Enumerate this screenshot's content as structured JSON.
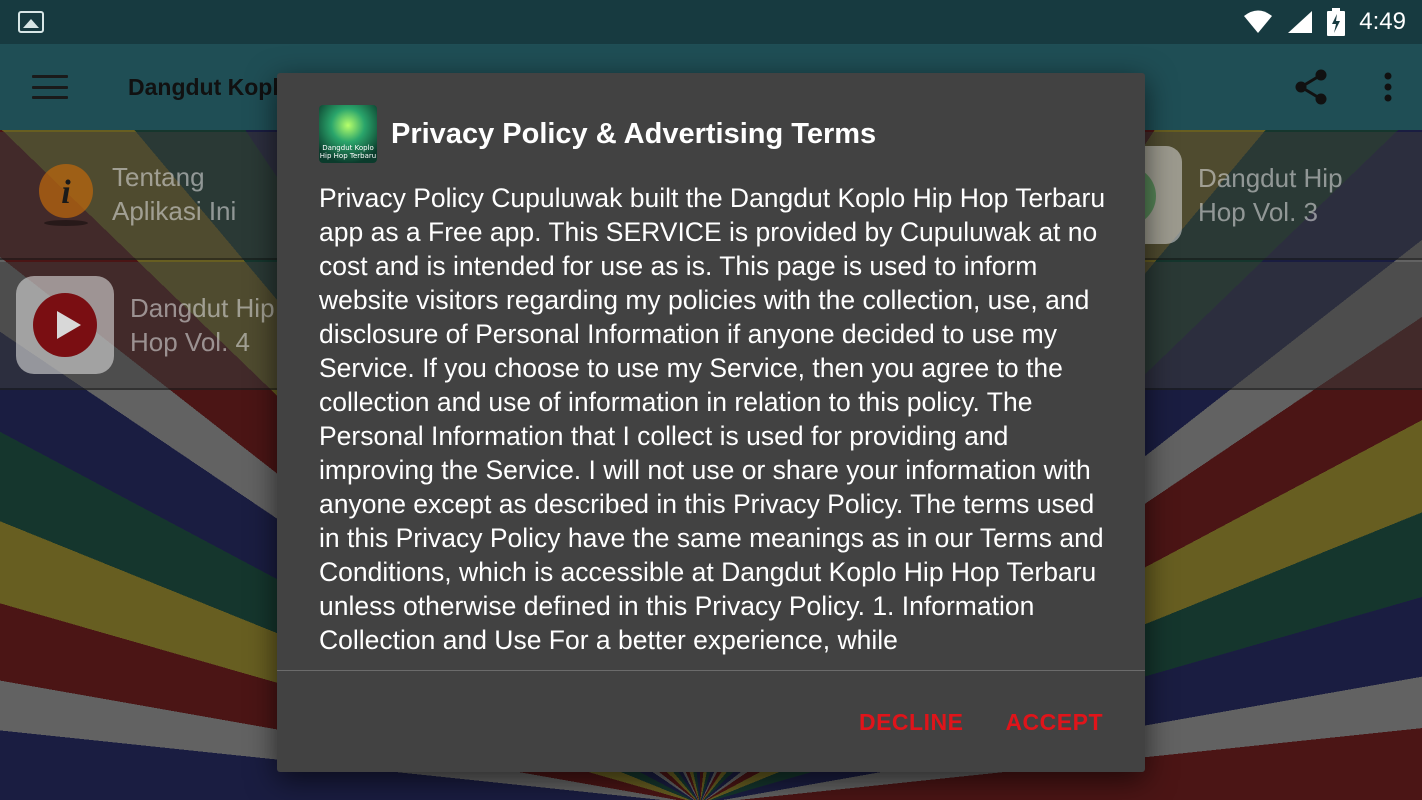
{
  "status_bar": {
    "time": "4:49",
    "icons": [
      "image-notification-icon",
      "wifi-icon",
      "cellular-signal-icon",
      "battery-charging-icon"
    ]
  },
  "app_bar": {
    "title": "Dangdut Kopl",
    "menu_icon": "hamburger-menu-icon",
    "share_icon": "share-icon",
    "overflow_icon": "more-vert-icon"
  },
  "menu": {
    "items": [
      {
        "label": "Tentang Aplikasi Ini",
        "icon": "info-icon"
      },
      {
        "label": "Dangdut Hip Hop Vol. 3",
        "icon": "app-icon"
      },
      {
        "label": "Dangdut Hip Hop Vol. 4",
        "icon": "play-icon"
      }
    ]
  },
  "dialog": {
    "title": "Privacy Policy & Advertising Terms",
    "icon_caption": "Dangdut Koplo Hip Hop Terbaru",
    "body": "Privacy Policy Cupuluwak built the Dangdut Koplo Hip Hop Terbaru app as a Free app. This SERVICE is provided by Cupuluwak at no cost and is intended for use as is. This page is used to inform website visitors regarding my policies with the collection, use, and disclosure of Personal Information if anyone decided to use my Service. If you choose to use my Service, then you agree to the collection and use of information in relation to this policy. The Personal Information that I collect is used for providing and improving the Service. I will not use or share your information with anyone except as described in this Privacy Policy. The terms used in this Privacy Policy have the same meanings as in our Terms and Conditions, which is accessible at Dangdut Koplo Hip Hop Terbaru unless otherwise defined in this Privacy Policy. 1. Information Collection and Use For a better experience, while",
    "decline_label": "DECLINE",
    "accept_label": "ACCEPT"
  },
  "colors": {
    "status_bar": "#173a40",
    "app_bar": "#1f4e55",
    "dialog_bg": "#424242",
    "dialog_button": "#e0141a"
  }
}
